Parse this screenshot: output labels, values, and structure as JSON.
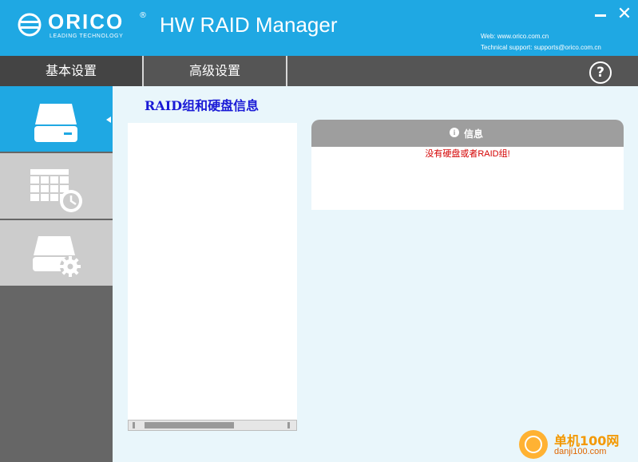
{
  "window": {
    "brand": "ORICO",
    "reg_mark": "®",
    "tagline": "LEADING TECHNOLOGY",
    "app_title": "HW RAID Manager",
    "minimize_glyph": "−",
    "close_glyph": "✕",
    "web_text": "Web: www.orico.com.cn",
    "support_text": "Technical support: supports@orico.com.cn"
  },
  "tabs": [
    {
      "label": "基本设置",
      "active": true
    },
    {
      "label": "高级设置",
      "active": false
    }
  ],
  "help_glyph": "?",
  "sidebar": {
    "items": [
      {
        "icon": "hard-drive-icon",
        "active": true
      },
      {
        "icon": "schedule-grid-clock-icon",
        "active": false
      },
      {
        "icon": "drive-settings-gear-icon",
        "active": false
      }
    ]
  },
  "main": {
    "section_title": "RAID组和硬盘信息",
    "info": {
      "icon_glyph": "i",
      "title": "信息",
      "message": "没有硬盘或者RAID组!"
    }
  },
  "watermark": {
    "cn": "单机100网",
    "en": "danji100.com"
  },
  "colors": {
    "accent": "#1fa8e3",
    "tab_bg": "#555555",
    "sidebar_bg": "#666666",
    "sidebar_item_inactive": "#cccccc",
    "error_text": "#d40000",
    "section_title": "#1a1ad6"
  }
}
